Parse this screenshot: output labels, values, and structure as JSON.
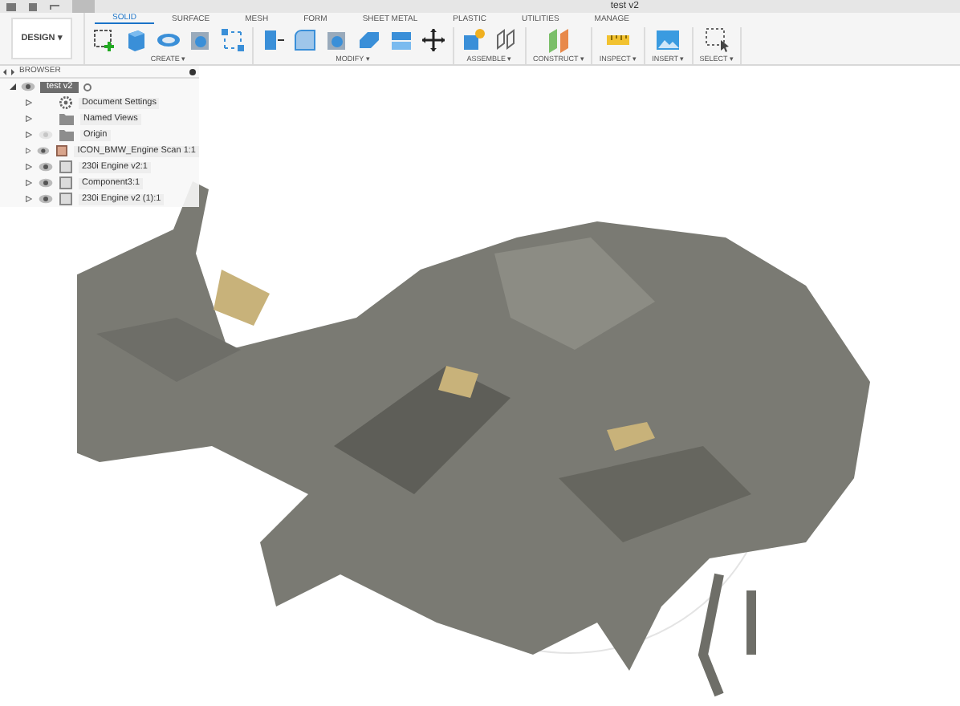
{
  "document_title": "test v2",
  "workspace_button": "DESIGN ▾",
  "tabs": [
    {
      "label": "SOLID",
      "selected": true
    },
    {
      "label": "SURFACE",
      "selected": false
    },
    {
      "label": "MESH",
      "selected": false
    },
    {
      "label": "FORM",
      "selected": false
    },
    {
      "label": "SHEET METAL",
      "selected": false
    },
    {
      "label": "PLASTIC",
      "selected": false
    },
    {
      "label": "UTILITIES",
      "selected": false
    },
    {
      "label": "MANAGE",
      "selected": false
    }
  ],
  "tool_groups": [
    {
      "label": "CREATE ▾",
      "tools": [
        {
          "kind": "sketch"
        },
        {
          "kind": "box"
        },
        {
          "kind": "sweep"
        },
        {
          "kind": "shell"
        },
        {
          "kind": "points"
        }
      ]
    },
    {
      "label": "MODIFY ▾",
      "tools": [
        {
          "kind": "press"
        },
        {
          "kind": "fillet"
        },
        {
          "kind": "shell"
        },
        {
          "kind": "combine"
        },
        {
          "kind": "split"
        },
        {
          "kind": "move"
        }
      ]
    },
    {
      "label": "ASSEMBLE ▾",
      "tools": [
        {
          "kind": "component"
        },
        {
          "kind": "joint"
        }
      ]
    },
    {
      "label": "CONSTRUCT ▾",
      "tools": [
        {
          "kind": "plane"
        }
      ]
    },
    {
      "label": "INSPECT ▾",
      "tools": [
        {
          "kind": "measure"
        }
      ]
    },
    {
      "label": "INSERT ▾",
      "tools": [
        {
          "kind": "image"
        }
      ]
    },
    {
      "label": "SELECT ▾",
      "tools": [
        {
          "kind": "select"
        }
      ]
    }
  ],
  "browser": {
    "title": "BROWSER",
    "root": {
      "label": "test v2",
      "selected": true,
      "expanded": true,
      "children": [
        {
          "label": "Document Settings",
          "kind": "settings"
        },
        {
          "label": "Named Views",
          "kind": "folder"
        },
        {
          "label": "Origin",
          "kind": "folder",
          "visible": false
        },
        {
          "label": "ICON_BMW_Engine Scan 1:1",
          "kind": "mesh",
          "visible": true
        },
        {
          "label": "230i Engine v2:1",
          "kind": "component",
          "visible": true
        },
        {
          "label": "Component3:1",
          "kind": "component",
          "visible": true
        },
        {
          "label": "230i Engine v2 (1):1",
          "kind": "component",
          "visible": true
        }
      ]
    }
  }
}
